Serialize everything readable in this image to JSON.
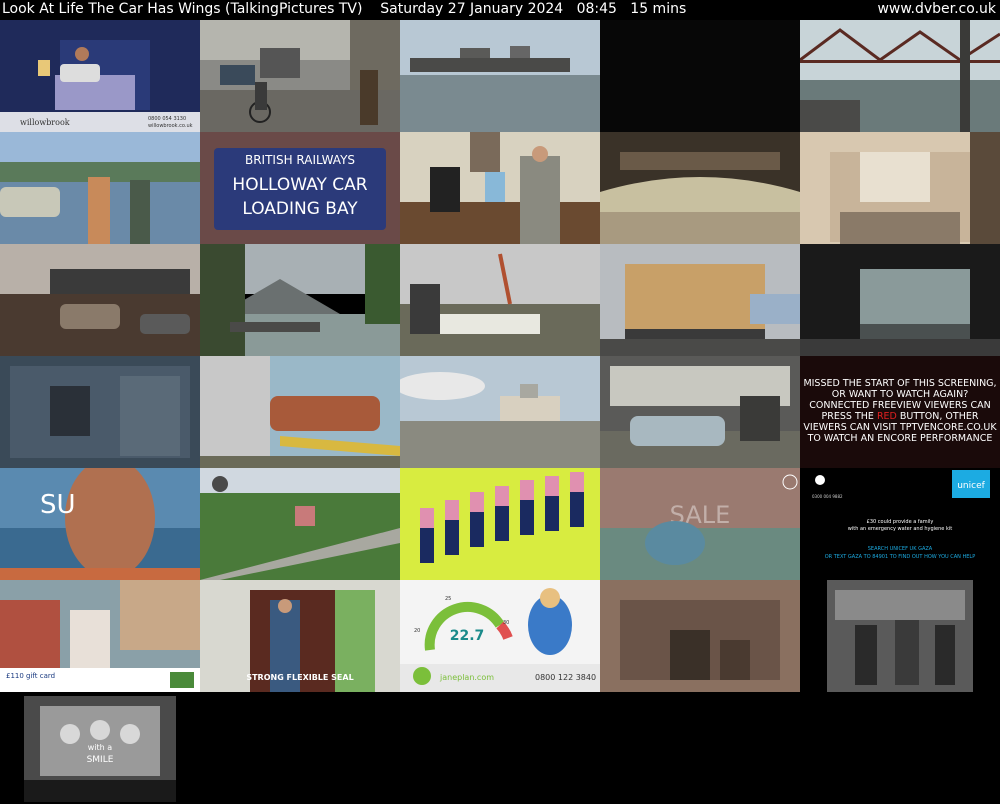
{
  "header": {
    "program": "Look At Life The Car Has Wings (TalkingPictures TV)",
    "date": "Saturday 27 January 2024",
    "time": "08:45",
    "duration": "15 mins",
    "site": "www.dvber.co.uk"
  },
  "tiles": {
    "t0": {
      "logo": "willowbrook",
      "phone": "0800 054 3130",
      "url": "willowbrook.co.uk"
    },
    "t6": {
      "sign": [
        "BRITISH RAILWAYS",
        "HOLLOWAY CAR",
        "LOADING BAY"
      ]
    },
    "t19": {
      "lines": [
        "MISSED THE START OF THIS SCREENING,",
        "OR WANT TO WATCH AGAIN?",
        "CONNECTED FREEVIEW VIEWERS CAN",
        "PRESS THE ",
        "RED",
        " BUTTON, OTHER",
        "VIEWERS CAN VISIT TPTVENCORE.CO.UK",
        "TO WATCH AN ENCORE PERFORMANCE"
      ]
    },
    "t20": {
      "big": "SU"
    },
    "t24": {
      "brand": "unicef",
      "line1": "£30 could provide a family",
      "line2": "with an emergency water and hygiene kit",
      "cta1": "SEARCH UNICEF UK GAZA",
      "cta2": "OR TEXT GAZA TO 84901 TO FIND OUT HOW YOU CAN HELP",
      "phone": "0300 004 9882"
    },
    "t25": {
      "gift": "£110 gift card"
    },
    "t26": {
      "caption": "STRONG FLEXIBLE SEAL"
    },
    "t27": {
      "gauge": "22.7",
      "left": "20",
      "top": "25",
      "right": "30",
      "brand": "janeplan.com",
      "phone": "0800 122 3840"
    },
    "t28": {
      "word": "SALE"
    },
    "t30": {
      "words": [
        "with a",
        "SMILE"
      ]
    }
  },
  "colors": {
    "red": "#e02020",
    "unicef_blue": "#1cabe2",
    "janeplan_green": "#7bbf3a",
    "br_sign_blue": "#2b3a7a"
  }
}
